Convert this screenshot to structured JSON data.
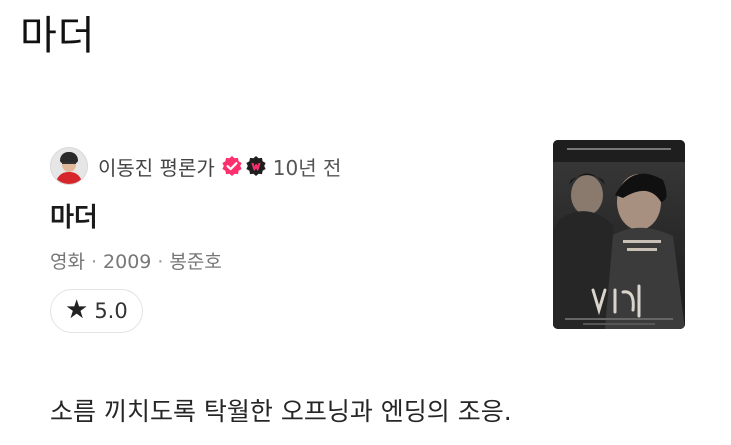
{
  "page": {
    "title": "마더"
  },
  "review": {
    "author_name": "이동진 평론가",
    "time_ago": "10년 전",
    "title": "마더",
    "meta": {
      "category": "영화",
      "year": "2009",
      "director": "봉준호"
    },
    "rating": "5.0",
    "excerpt": "소름 끼치도록 탁월한 오프닝과 엔딩의 조응."
  },
  "icons": {
    "avatar": "author-avatar",
    "verified": "verified-badge-icon",
    "watcha": "watcha-badge-icon",
    "star": "star-icon"
  },
  "colors": {
    "verified_badge": "#ff2f6e",
    "watcha_badge": "#1f1f1f",
    "watcha_badge_mark": "#ff2f6e",
    "text_primary": "#1a1a1a",
    "text_secondary": "#777777"
  }
}
